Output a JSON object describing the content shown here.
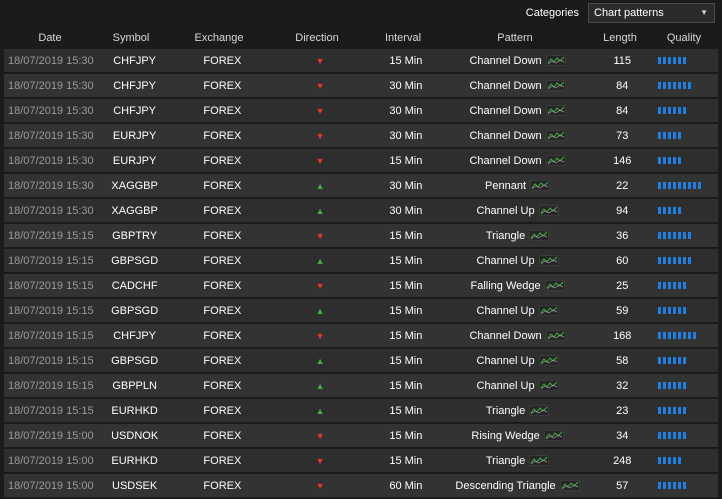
{
  "toolbar": {
    "categories_label": "Categories",
    "categories_value": "Chart patterns"
  },
  "columns": [
    "Date",
    "Symbol",
    "Exchange",
    "Direction",
    "Interval",
    "Pattern",
    "Length",
    "Quality"
  ],
  "colors": {
    "down": "#e0392b",
    "up": "#3fae3f",
    "quality": "#1e7fe0"
  },
  "rows": [
    {
      "date": "18/07/2019 15:30",
      "symbol": "CHFJPY",
      "exchange": "FOREX",
      "direction": "down",
      "interval": "15 Min",
      "pattern": "Channel Down",
      "length": "115",
      "quality": 6
    },
    {
      "date": "18/07/2019 15:30",
      "symbol": "CHFJPY",
      "exchange": "FOREX",
      "direction": "down",
      "interval": "30 Min",
      "pattern": "Channel Down",
      "length": "84",
      "quality": 7
    },
    {
      "date": "18/07/2019 15:30",
      "symbol": "CHFJPY",
      "exchange": "FOREX",
      "direction": "down",
      "interval": "30 Min",
      "pattern": "Channel Down",
      "length": "84",
      "quality": 6
    },
    {
      "date": "18/07/2019 15:30",
      "symbol": "EURJPY",
      "exchange": "FOREX",
      "direction": "down",
      "interval": "30 Min",
      "pattern": "Channel Down",
      "length": "73",
      "quality": 5
    },
    {
      "date": "18/07/2019 15:30",
      "symbol": "EURJPY",
      "exchange": "FOREX",
      "direction": "down",
      "interval": "15 Min",
      "pattern": "Channel Down",
      "length": "146",
      "quality": 5
    },
    {
      "date": "18/07/2019 15:30",
      "symbol": "XAGGBP",
      "exchange": "FOREX",
      "direction": "up",
      "interval": "30 Min",
      "pattern": "Pennant",
      "length": "22",
      "quality": 9
    },
    {
      "date": "18/07/2019 15:30",
      "symbol": "XAGGBP",
      "exchange": "FOREX",
      "direction": "up",
      "interval": "30 Min",
      "pattern": "Channel Up",
      "length": "94",
      "quality": 5
    },
    {
      "date": "18/07/2019 15:15",
      "symbol": "GBPTRY",
      "exchange": "FOREX",
      "direction": "down",
      "interval": "15 Min",
      "pattern": "Triangle",
      "length": "36",
      "quality": 7
    },
    {
      "date": "18/07/2019 15:15",
      "symbol": "GBPSGD",
      "exchange": "FOREX",
      "direction": "up",
      "interval": "15 Min",
      "pattern": "Channel Up",
      "length": "60",
      "quality": 7
    },
    {
      "date": "18/07/2019 15:15",
      "symbol": "CADCHF",
      "exchange": "FOREX",
      "direction": "down",
      "interval": "15 Min",
      "pattern": "Falling Wedge",
      "length": "25",
      "quality": 6
    },
    {
      "date": "18/07/2019 15:15",
      "symbol": "GBPSGD",
      "exchange": "FOREX",
      "direction": "up",
      "interval": "15 Min",
      "pattern": "Channel Up",
      "length": "59",
      "quality": 6
    },
    {
      "date": "18/07/2019 15:15",
      "symbol": "CHFJPY",
      "exchange": "FOREX",
      "direction": "down",
      "interval": "15 Min",
      "pattern": "Channel Down",
      "length": "168",
      "quality": 8
    },
    {
      "date": "18/07/2019 15:15",
      "symbol": "GBPSGD",
      "exchange": "FOREX",
      "direction": "up",
      "interval": "15 Min",
      "pattern": "Channel Up",
      "length": "58",
      "quality": 6
    },
    {
      "date": "18/07/2019 15:15",
      "symbol": "GBPPLN",
      "exchange": "FOREX",
      "direction": "up",
      "interval": "15 Min",
      "pattern": "Channel Up",
      "length": "32",
      "quality": 6
    },
    {
      "date": "18/07/2019 15:15",
      "symbol": "EURHKD",
      "exchange": "FOREX",
      "direction": "up",
      "interval": "15 Min",
      "pattern": "Triangle",
      "length": "23",
      "quality": 6
    },
    {
      "date": "18/07/2019 15:00",
      "symbol": "USDNOK",
      "exchange": "FOREX",
      "direction": "down",
      "interval": "15 Min",
      "pattern": "Rising Wedge",
      "length": "34",
      "quality": 6
    },
    {
      "date": "18/07/2019 15:00",
      "symbol": "EURHKD",
      "exchange": "FOREX",
      "direction": "down",
      "interval": "15 Min",
      "pattern": "Triangle",
      "length": "248",
      "quality": 5
    },
    {
      "date": "18/07/2019 15:00",
      "symbol": "USDSEK",
      "exchange": "FOREX",
      "direction": "down",
      "interval": "60 Min",
      "pattern": "Descending Triangle",
      "length": "57",
      "quality": 6
    }
  ]
}
